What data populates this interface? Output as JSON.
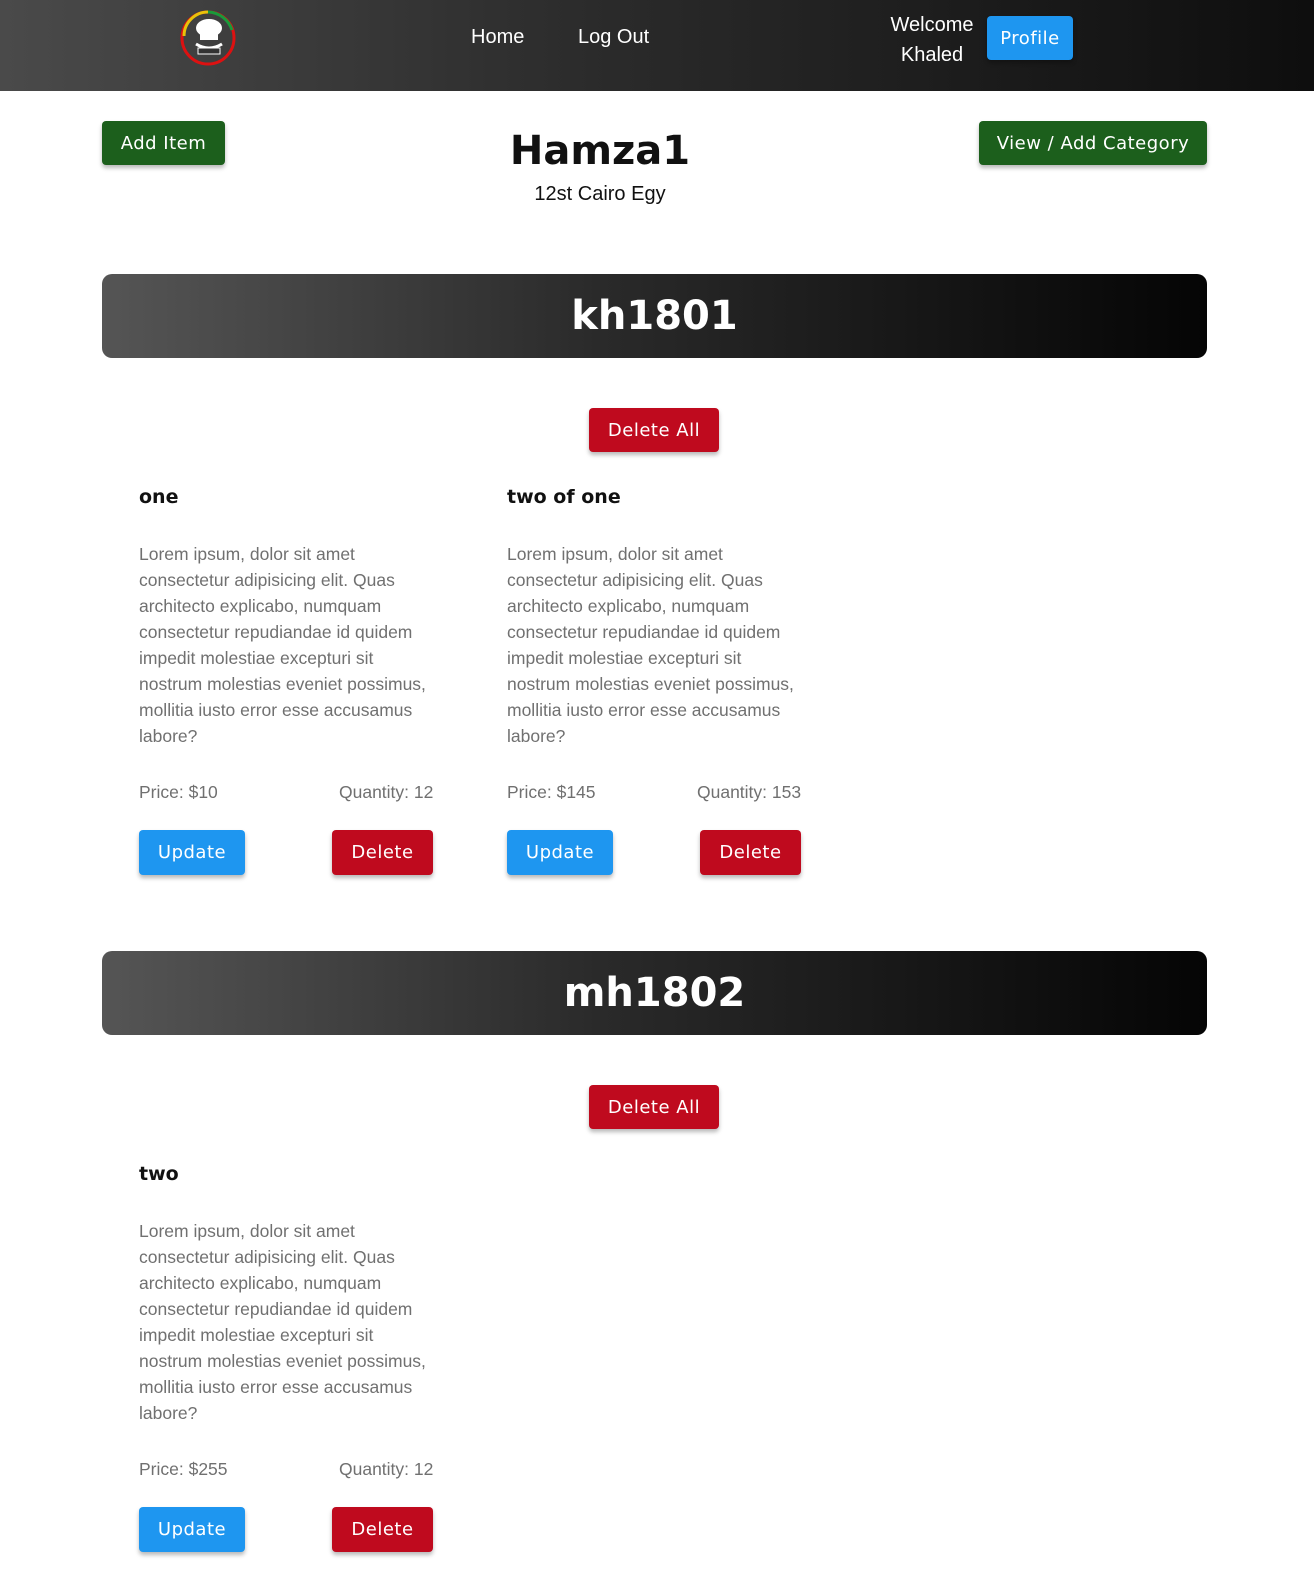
{
  "navbar": {
    "home_label": "Home",
    "logout_label": "Log Out",
    "welcome_text": "Welcome",
    "user_name": "Khaled",
    "profile_label": "Profile"
  },
  "header": {
    "add_item_label": "Add Item",
    "category_label": "View / Add Category",
    "store_name": "Hamza1",
    "store_address": "12st Cairo Egy"
  },
  "categories": [
    {
      "name": "kh1801",
      "delete_all_label": "Delete All",
      "items": [
        {
          "title": "one",
          "description": "Lorem ipsum, dolor sit amet consectetur adipisicing elit. Quas architecto explicabo, numquam consectetur repudiandae id quidem impedit molestiae excepturi sit nostrum molestias eveniet possimus, mollitia iusto error esse accusamus labore?",
          "price": "Price: $10",
          "quantity": "Quantity: 12",
          "update_label": "Update",
          "delete_label": "Delete"
        },
        {
          "title": "two of one",
          "description": "Lorem ipsum, dolor sit amet consectetur adipisicing elit. Quas architecto explicabo, numquam consectetur repudiandae id quidem impedit molestiae excepturi sit nostrum molestias eveniet possimus, mollitia iusto error esse accusamus labore?",
          "price": "Price: $145",
          "quantity": "Quantity: 153",
          "update_label": "Update",
          "delete_label": "Delete"
        }
      ]
    },
    {
      "name": "mh1802",
      "delete_all_label": "Delete All",
      "items": [
        {
          "title": "two",
          "description": "Lorem ipsum, dolor sit amet consectetur adipisicing elit. Quas architecto explicabo, numquam consectetur repudiandae id quidem impedit molestiae excepturi sit nostrum molestias eveniet possimus, mollitia iusto error esse accusamus labore?",
          "price": "Price: $255",
          "quantity": "Quantity: 12",
          "update_label": "Update",
          "delete_label": "Delete"
        }
      ]
    }
  ],
  "colors": {
    "primary_blue": "#1e96f0",
    "danger_red": "#bf0a1e",
    "success_green": "#1c5f1c"
  }
}
